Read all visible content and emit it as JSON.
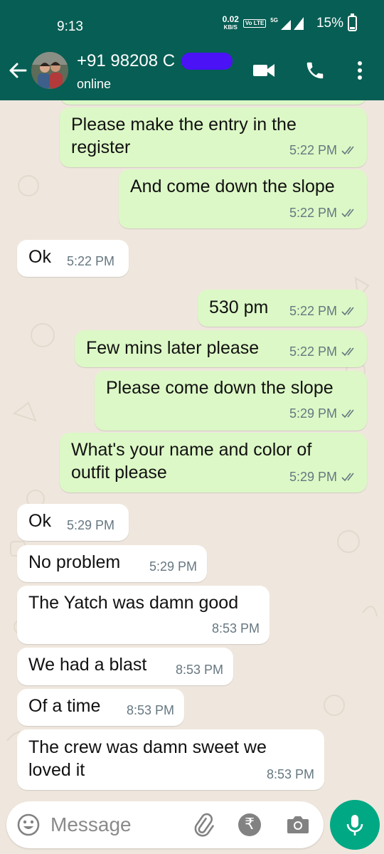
{
  "status_bar": {
    "time": "9:13",
    "speed_value": "0.02",
    "speed_unit": "KB/S",
    "volte": "Vo LTE",
    "network": "5G",
    "battery": "15%"
  },
  "header": {
    "contact_name": "+91 98208 C",
    "contact_status": "online",
    "colors": {
      "bar": "#075e54",
      "name_mask": "#4a12f5"
    },
    "icons": [
      "back-arrow-icon",
      "video-call-icon",
      "phone-icon",
      "more-vert-icon"
    ]
  },
  "messages": [
    {
      "text": "Please make the entry in the\nregister",
      "time": "5:22 PM"
    },
    {
      "text": "And come down the slope",
      "time": "5:22 PM"
    },
    {
      "text": "Ok",
      "time": "5:22 PM"
    },
    {
      "text": "530 pm",
      "time": "5:22 PM"
    },
    {
      "text": "Few mins later please",
      "time": "5:22 PM"
    },
    {
      "text": "Please come down the slope",
      "time": "5:29 PM"
    },
    {
      "text": "What's your name and color of\noutfit please",
      "time": "5:29 PM"
    },
    {
      "text": "Ok",
      "time": "5:29 PM"
    },
    {
      "text": "No problem",
      "time": "5:29 PM"
    },
    {
      "text": "The Yatch was damn good",
      "time": "8:53 PM"
    },
    {
      "text": "We had a blast",
      "time": "8:53 PM"
    },
    {
      "text": "Of a time",
      "time": "8:53 PM"
    },
    {
      "text": "The crew was damn sweet we\nloved it",
      "time": "8:53 PM"
    }
  ],
  "input": {
    "placeholder": "Message",
    "value": "",
    "icons": [
      "emoji-icon",
      "attach-icon",
      "rupee-icon",
      "camera-icon",
      "mic-icon"
    ]
  },
  "colors": {
    "outgoing_bubble": "#dcf8c6",
    "incoming_bubble": "#ffffff",
    "chat_background": "#efe7dd",
    "mic_button": "#00a884",
    "read_ticks": "#667781"
  }
}
